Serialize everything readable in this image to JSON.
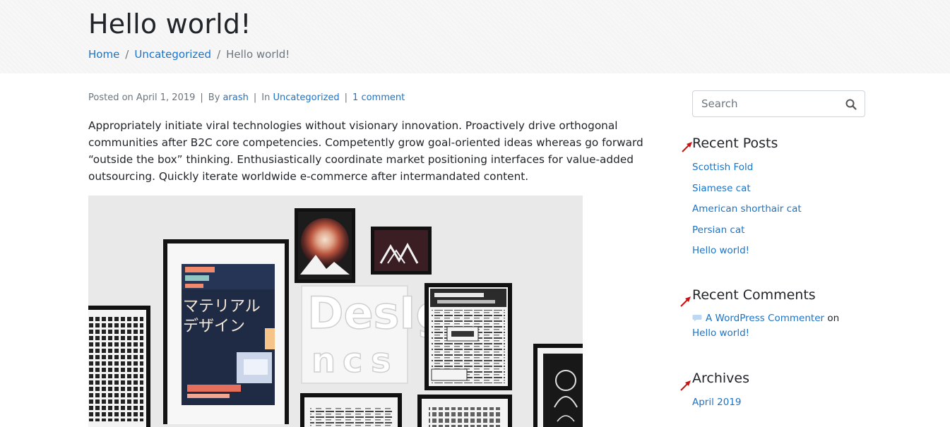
{
  "page": {
    "title": "Hello world!",
    "breadcrumb": [
      "Home",
      "Uncategorized",
      "Hello world!"
    ],
    "breadcrumb_separator": "/"
  },
  "post": {
    "posted_on_label": "Posted on",
    "date": "April 1, 2019",
    "by_label": "By",
    "author": "arash",
    "in_label": "In",
    "category": "Uncategorized",
    "comments": "1 comment",
    "body": "Appropriately initiate viral technologies without visionary innovation. Proactively drive orthogonal communities after B2C core competencies. Competently grow goal-oriented ideas whereas go forward “outside the box” thinking. Enthusiastically coordinate market positioning interfaces for value-added outsourcing. Quickly iterate worldwide e-commerce after intermandated content.",
    "image": {
      "poster_text_jp_line1": "マテリアル",
      "poster_text_jp_line2": "デザイン",
      "white_art_letters": "DesIgn"
    }
  },
  "sidebar": {
    "search": {
      "placeholder": "Search",
      "icon": "search-icon"
    },
    "recent_posts": {
      "title": "Recent Posts",
      "items": [
        "Scottish Fold",
        "Siamese cat",
        "American shorthair cat",
        "Persian cat",
        "Hello world!"
      ]
    },
    "recent_comments": {
      "title": "Recent Comments",
      "author": "A WordPress Commenter",
      "on_label": "on",
      "post": "Hello world!"
    },
    "archives": {
      "title": "Archives",
      "items": [
        "April 2019"
      ]
    }
  },
  "colors": {
    "link": "#1a73c8",
    "text": "#212529",
    "muted": "#6c757d",
    "annotation_arrow": "#cc1111"
  }
}
